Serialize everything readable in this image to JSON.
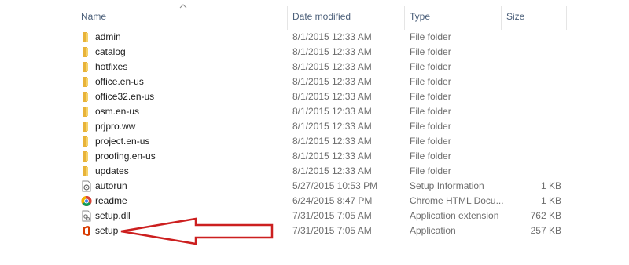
{
  "columns": {
    "name": "Name",
    "date": "Date modified",
    "type": "Type",
    "size": "Size"
  },
  "files": [
    {
      "name": "admin",
      "date": "8/1/2015 12:33 AM",
      "type": "File folder",
      "size": "",
      "icon": "folder-icon"
    },
    {
      "name": "catalog",
      "date": "8/1/2015 12:33 AM",
      "type": "File folder",
      "size": "",
      "icon": "folder-icon"
    },
    {
      "name": "hotfixes",
      "date": "8/1/2015 12:33 AM",
      "type": "File folder",
      "size": "",
      "icon": "folder-icon"
    },
    {
      "name": "office.en-us",
      "date": "8/1/2015 12:33 AM",
      "type": "File folder",
      "size": "",
      "icon": "folder-icon"
    },
    {
      "name": "office32.en-us",
      "date": "8/1/2015 12:33 AM",
      "type": "File folder",
      "size": "",
      "icon": "folder-icon"
    },
    {
      "name": "osm.en-us",
      "date": "8/1/2015 12:33 AM",
      "type": "File folder",
      "size": "",
      "icon": "folder-icon"
    },
    {
      "name": "prjpro.ww",
      "date": "8/1/2015 12:33 AM",
      "type": "File folder",
      "size": "",
      "icon": "folder-icon"
    },
    {
      "name": "project.en-us",
      "date": "8/1/2015 12:33 AM",
      "type": "File folder",
      "size": "",
      "icon": "folder-icon"
    },
    {
      "name": "proofing.en-us",
      "date": "8/1/2015 12:33 AM",
      "type": "File folder",
      "size": "",
      "icon": "folder-icon"
    },
    {
      "name": "updates",
      "date": "8/1/2015 12:33 AM",
      "type": "File folder",
      "size": "",
      "icon": "folder-icon"
    },
    {
      "name": "autorun",
      "date": "5/27/2015 10:53 PM",
      "type": "Setup Information",
      "size": "1 KB",
      "icon": "setup-info-icon"
    },
    {
      "name": "readme",
      "date": "6/24/2015 8:47 PM",
      "type": "Chrome HTML Docu...",
      "size": "1 KB",
      "icon": "chrome-icon"
    },
    {
      "name": "setup.dll",
      "date": "7/31/2015 7:05 AM",
      "type": "Application extension",
      "size": "762 KB",
      "icon": "dll-icon"
    },
    {
      "name": "setup",
      "date": "7/31/2015 7:05 AM",
      "type": "Application",
      "size": "257 KB",
      "icon": "office-setup-icon"
    }
  ],
  "colors": {
    "folder": "#e8b339",
    "arrow": "#cc1f1f",
    "office": "#d83b01",
    "header_text": "#4c607a"
  }
}
